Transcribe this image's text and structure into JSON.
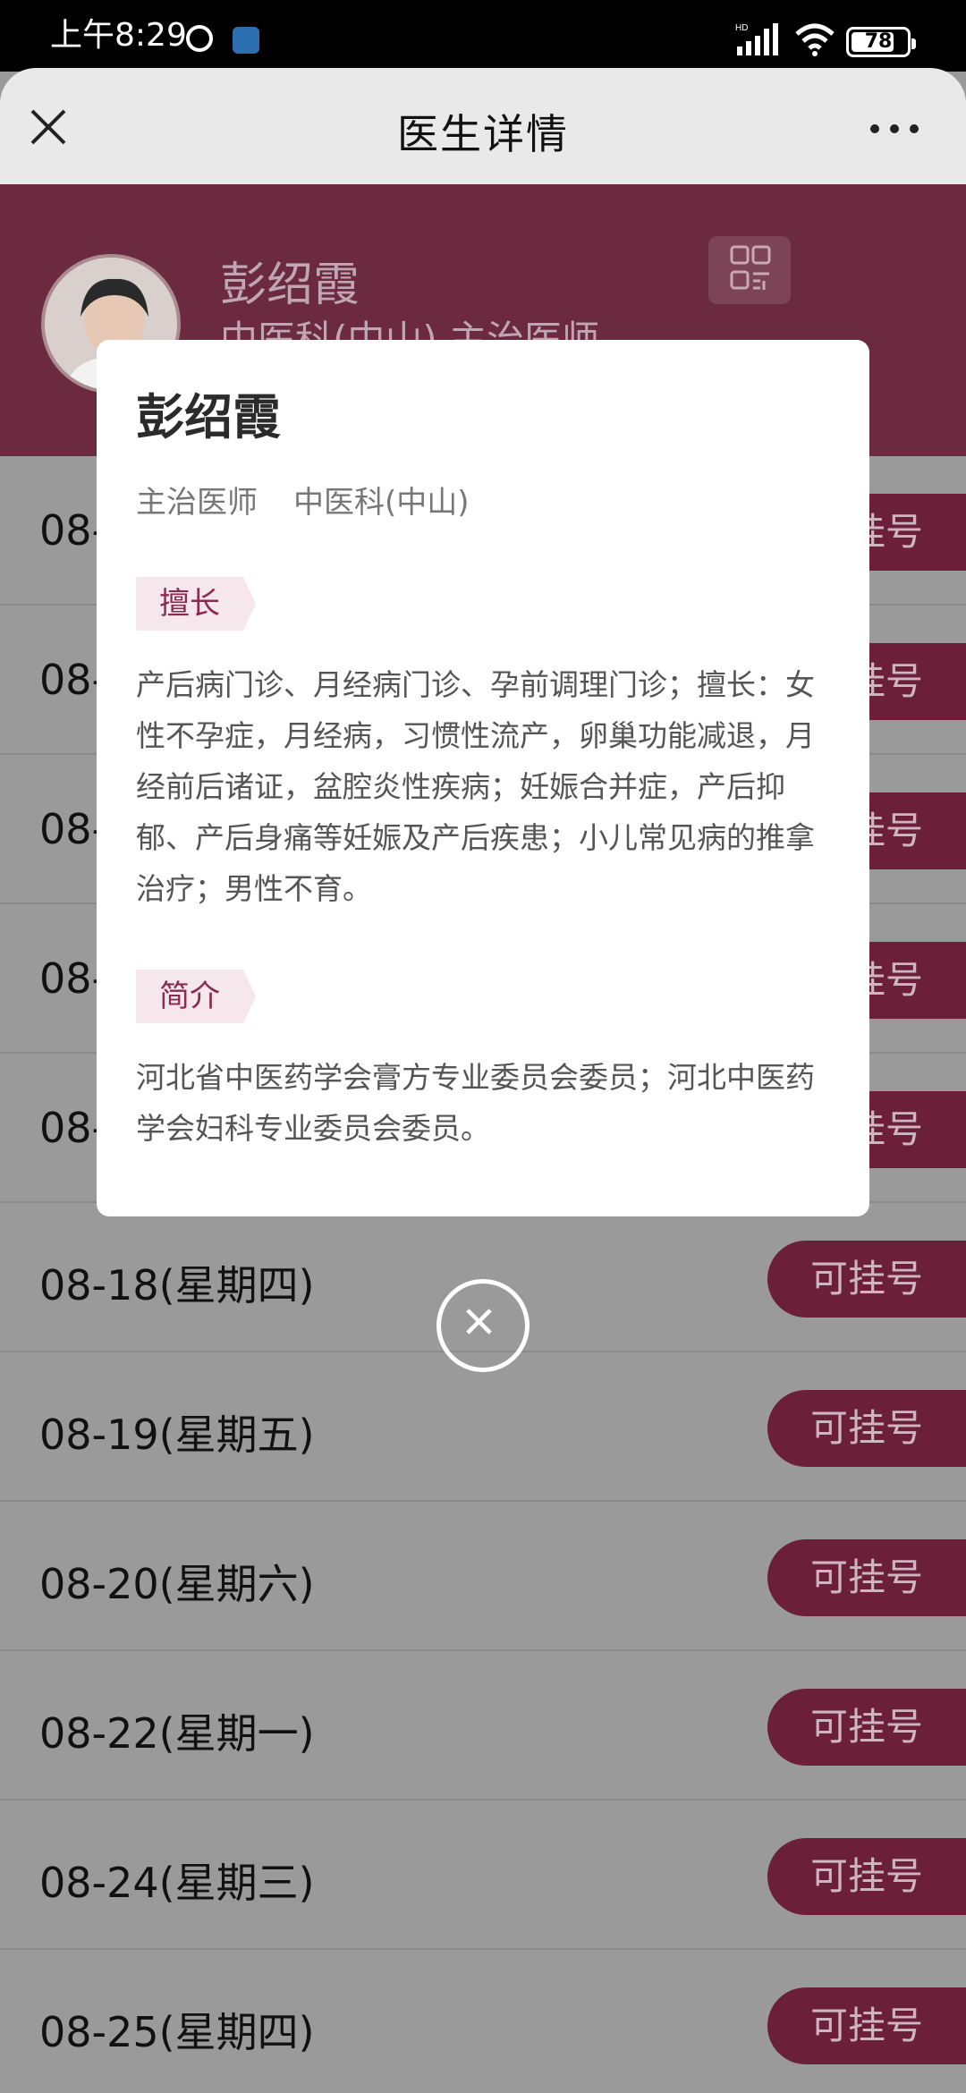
{
  "status_bar": {
    "time": "上午8:29",
    "battery": "78",
    "battery_level": 0.78,
    "icons": [
      "alarm-icon",
      "shield-icon",
      "signal-icon",
      "wifi-icon",
      "battery-icon"
    ]
  },
  "app_bar": {
    "title": "医生详情",
    "left_icon": "close-icon",
    "right_icon": "more-icon"
  },
  "doctor": {
    "name": "彭绍霞",
    "dept_title_prefix": "中医科(中山) 主治医师"
  },
  "schedule": {
    "button_label": "可挂号",
    "rows": [
      {
        "date": "08-"
      },
      {
        "date": "08-"
      },
      {
        "date": "08-"
      },
      {
        "date": "08-"
      },
      {
        "date": "08-"
      },
      {
        "date": "08-18(星期四)"
      },
      {
        "date": "08-19(星期五)"
      },
      {
        "date": "08-20(星期六)"
      },
      {
        "date": "08-22(星期一)"
      },
      {
        "date": "08-24(星期三)"
      },
      {
        "date": "08-25(星期四)"
      }
    ]
  },
  "modal": {
    "name": "彭绍霞",
    "title": "主治医师",
    "department": "中医科(中山)",
    "specialty_tag": "擅长",
    "specialty_text": "产后病门诊、月经病门诊、孕前调理门诊；擅长：女性不孕症，月经病，习惯性流产，卵巢功能减退，月经前后诸证，盆腔炎性疾病；妊娠合并症，产后抑郁、产后身痛等妊娠及产后疾患；小儿常见病的推拿治疗；男性不育。",
    "intro_tag": "简介",
    "intro_text": "河北省中医药学会膏方专业委员会委员；河北中医药学会妇科专业委员会委员。"
  },
  "colors": {
    "brand": "#8b2b4f",
    "tag_bg": "#f6e7ed"
  }
}
